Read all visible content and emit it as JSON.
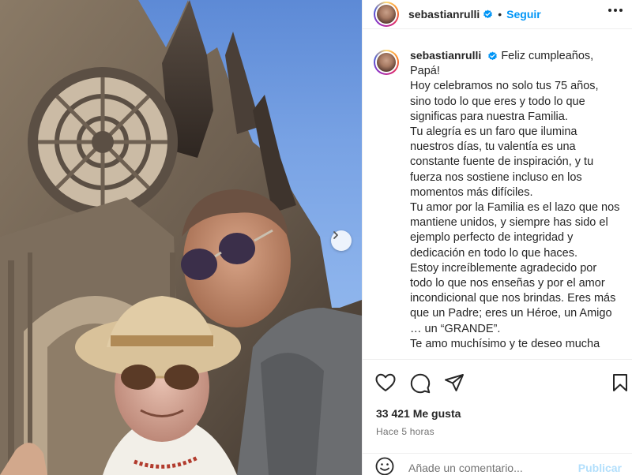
{
  "post": {
    "username": "sebastianrulli",
    "follow_label": "Seguir",
    "separator": "•",
    "caption_lines": [
      "Feliz cumpleaños, Papá!",
      "Hoy celebramos no solo tus 75 años, sino todo lo que eres y todo lo que significas para nuestra Familia.",
      "Tu alegría es un faro que ilumina nuestros días, tu valentía es una constante fuente de inspiración, y tu fuerza nos sostiene incluso en los momentos más difíciles.",
      "Tu amor por la Familia es el lazo que nos mantiene unidos, y siempre has sido el ejemplo perfecto de integridad y dedicación en todo lo que haces.",
      "Estoy increíblemente agradecido por todo lo que nos enseñas y por el amor incondicional que nos brindas. Eres más que un Padre; eres un Héroe, un Amigo … un “GRANDE”.",
      "Te amo muchísimo y te deseo mucha"
    ],
    "likes": "33 421 Me gusta",
    "time_ago": "Hace 5 horas",
    "comment_placeholder": "Añade un comentario...",
    "publish_label": "Publicar"
  },
  "icons": [
    "verified-badge-icon",
    "more-options-icon",
    "heart-icon",
    "comment-icon",
    "share-icon",
    "bookmark-icon",
    "emoji-icon",
    "carousel-next-icon"
  ],
  "colors": {
    "accent": "#0095f6",
    "publish_disabled": "#b2dffc",
    "muted": "#737373",
    "text": "#262626",
    "border": "#efefef"
  }
}
